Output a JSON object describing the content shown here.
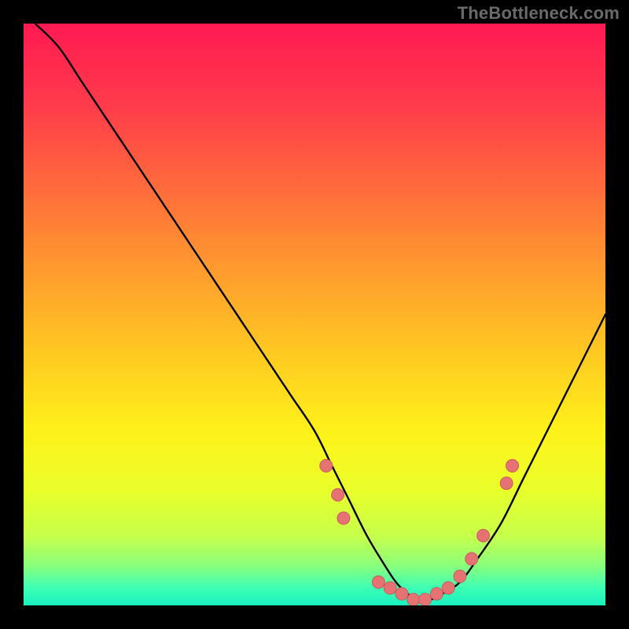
{
  "watermark": "TheBottleneck.com",
  "colors": {
    "curve_stroke": "#000000",
    "marker_fill": "#e57373",
    "marker_stroke": "#cc5a5a"
  },
  "chart_data": {
    "type": "line",
    "title": "",
    "xlabel": "",
    "ylabel": "",
    "xlim": [
      0,
      100
    ],
    "ylim": [
      0,
      100
    ],
    "gradient_meaning": "red=high bottleneck, green=low bottleneck",
    "series": [
      {
        "name": "bottleneck-curve",
        "x": [
          2,
          6,
          10,
          14,
          18,
          22,
          26,
          30,
          34,
          38,
          42,
          46,
          50,
          53,
          56,
          59,
          62,
          64,
          66,
          68,
          70,
          72,
          75,
          78,
          82,
          86,
          90,
          94,
          98,
          100
        ],
        "y": [
          100,
          96,
          90,
          84,
          78,
          72,
          66,
          60,
          54,
          48,
          42,
          36,
          30,
          24,
          18,
          12,
          7,
          4,
          2,
          1,
          1,
          2,
          4,
          8,
          14,
          22,
          30,
          38,
          46,
          50
        ]
      }
    ],
    "markers": [
      {
        "x": 52,
        "y": 24
      },
      {
        "x": 54,
        "y": 19
      },
      {
        "x": 55,
        "y": 15
      },
      {
        "x": 61,
        "y": 4
      },
      {
        "x": 63,
        "y": 3
      },
      {
        "x": 65,
        "y": 2
      },
      {
        "x": 67,
        "y": 1
      },
      {
        "x": 69,
        "y": 1
      },
      {
        "x": 71,
        "y": 2
      },
      {
        "x": 73,
        "y": 3
      },
      {
        "x": 75,
        "y": 5
      },
      {
        "x": 77,
        "y": 8
      },
      {
        "x": 79,
        "y": 12
      },
      {
        "x": 83,
        "y": 21
      },
      {
        "x": 84,
        "y": 24
      }
    ]
  }
}
